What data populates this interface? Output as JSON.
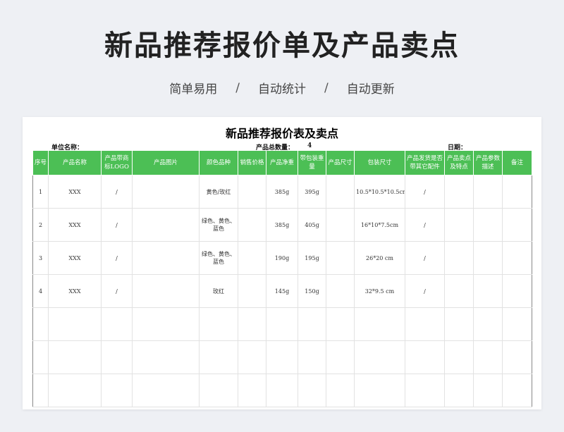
{
  "hero": {
    "title": "新品推荐报价单及产品卖点",
    "features": [
      "简单易用",
      "自动统计",
      "自动更新"
    ],
    "separator": "/"
  },
  "sheet": {
    "title": "新品推荐报价表及卖点",
    "unit_label": "单位名称：",
    "total_label": "产品总数量：",
    "total_value": "4",
    "date_label": "日期："
  },
  "table": {
    "headers": [
      "序号",
      "产品名称",
      "产品带商标LOGO",
      "产品图片",
      "颜色品种",
      "销售价格",
      "产品净重",
      "带包装重量",
      "产品尺寸",
      "包装尺寸",
      "产品发货是否带其它配件",
      "产品卖点及特点",
      "产品参数描述",
      "备注"
    ],
    "rows": [
      [
        "1",
        "XXX",
        "/",
        "",
        "黄色/玫红",
        "",
        "385g",
        "395g",
        "",
        "10.5*10.5*10.5cm",
        "/",
        "",
        "",
        ""
      ],
      [
        "2",
        "XXX",
        "/",
        "",
        "绿色、黄色、蓝色",
        "",
        "385g",
        "405g",
        "",
        "16*10*7.5cm",
        "/",
        "",
        "",
        ""
      ],
      [
        "3",
        "XXX",
        "/",
        "",
        "绿色、黄色、蓝色",
        "",
        "190g",
        "195g",
        "",
        "26*20 cm",
        "/",
        "",
        "",
        ""
      ],
      [
        "4",
        "XXX",
        "/",
        "",
        "玫红",
        "",
        "145g",
        "150g",
        "",
        "32*9.5 cm",
        "/",
        "",
        "",
        ""
      ]
    ],
    "empty_rows": 3
  },
  "colors": {
    "header_green": "#4cbf55",
    "background": "#eef0f4"
  }
}
